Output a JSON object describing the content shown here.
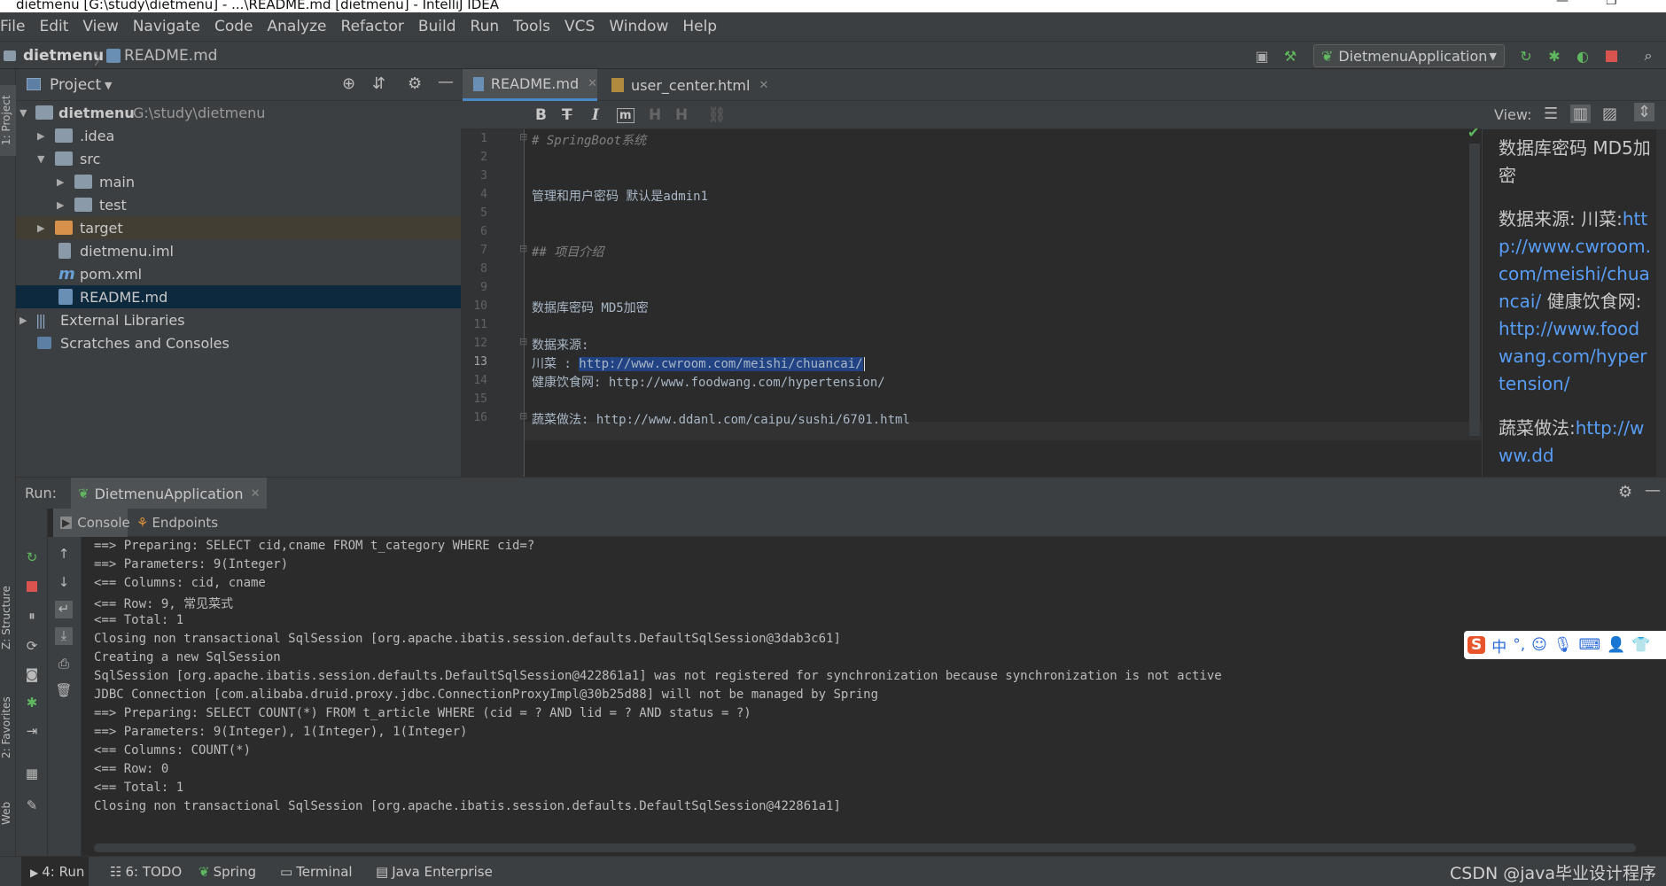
{
  "window": {
    "title": "dietmenu [G:\\study\\dietmenu] - ...\\README.md [dietmenu] - IntelliJ IDEA"
  },
  "menu": [
    "File",
    "Edit",
    "View",
    "Navigate",
    "Code",
    "Analyze",
    "Refactor",
    "Build",
    "Run",
    "Tools",
    "VCS",
    "Window",
    "Help"
  ],
  "navbar": {
    "project": "dietmenu",
    "file": "README.md",
    "run_config": "DietmenuApplication"
  },
  "project_panel": {
    "title": "Project",
    "tree": [
      {
        "label": "dietmenu",
        "path": "G:\\study\\dietmenu",
        "level": 0
      },
      {
        "label": ".idea",
        "level": 1
      },
      {
        "label": "src",
        "level": 1
      },
      {
        "label": "main",
        "level": 2
      },
      {
        "label": "test",
        "level": 2
      },
      {
        "label": "target",
        "level": 1
      },
      {
        "label": "dietmenu.iml",
        "level": 1
      },
      {
        "label": "pom.xml",
        "level": 1
      },
      {
        "label": "README.md",
        "level": 1
      },
      {
        "label": "External Libraries",
        "level": 0
      },
      {
        "label": "Scratches and Consoles",
        "level": 0
      }
    ]
  },
  "editor": {
    "tabs": [
      {
        "label": "README.md",
        "active": true
      },
      {
        "label": "user_center.html",
        "active": false
      }
    ],
    "toolbar": {
      "bold": "B",
      "strike": "T",
      "italic": "I",
      "code": "m",
      "h1": "H",
      "h2": "H"
    },
    "lines": [
      {
        "n": "1",
        "text": "# SpringBoot系统"
      },
      {
        "n": "2",
        "text": ""
      },
      {
        "n": "3",
        "text": ""
      },
      {
        "n": "4",
        "text": "管理和用户密码 默认是admin1"
      },
      {
        "n": "5",
        "text": ""
      },
      {
        "n": "6",
        "text": ""
      },
      {
        "n": "7",
        "text": "## 项目介绍"
      },
      {
        "n": "8",
        "text": ""
      },
      {
        "n": "9",
        "text": ""
      },
      {
        "n": "10",
        "text": "数据库密码  MD5加密"
      },
      {
        "n": "11",
        "text": ""
      },
      {
        "n": "12",
        "text": "数据来源:"
      },
      {
        "n": "13",
        "text_prefix": "川菜 :",
        "text_selected": "http://www.cwroom.com/meishi/chuancai/"
      },
      {
        "n": "14",
        "text": "健康饮食网: http://www.foodwang.com/hypertension/"
      },
      {
        "n": "15",
        "text": ""
      },
      {
        "n": "16",
        "text": "蔬菜做法: http://www.ddanl.com/caipu/sushi/6701.html"
      }
    ]
  },
  "preview": {
    "view_label": "View:",
    "p1": "数据库密码 MD5加密",
    "p2_prefix": "数据来源: 川菜:",
    "p2_link1": "http://www.cwroom.com/meishi/chuancai/",
    "p2_mid": "健康饮食网:",
    "p2_link2": "http://www.foodwang.com/hypertension/",
    "p3_prefix": "蔬菜做法:",
    "p3_link": "http://www.dd"
  },
  "run": {
    "label": "Run:",
    "config": "DietmenuApplication",
    "subtabs": [
      "Console",
      "Endpoints"
    ],
    "console": [
      "==>  Preparing: SELECT cid,cname FROM t_category WHERE cid=?",
      "==> Parameters: 9(Integer)",
      "<==    Columns: cid, cname",
      "<==        Row: 9, 常见菜式",
      "<==      Total: 1",
      "Closing non transactional SqlSession [org.apache.ibatis.session.defaults.DefaultSqlSession@3dab3c61]",
      "Creating a new SqlSession",
      "SqlSession [org.apache.ibatis.session.defaults.DefaultSqlSession@422861a1] was not registered for synchronization because synchronization is not active",
      "JDBC Connection [com.alibaba.druid.proxy.jdbc.ConnectionProxyImpl@30b25d88] will not be managed by Spring",
      "==>  Preparing: SELECT COUNT(*) FROM t_article WHERE (cid = ? AND lid = ? AND status = ?)",
      "==> Parameters: 9(Integer), 1(Integer), 1(Integer)",
      "<==    Columns: COUNT(*)",
      "<==        Row: 0",
      "<==      Total: 1",
      "Closing non transactional SqlSession [org.apache.ibatis.session.defaults.DefaultSqlSession@422861a1]"
    ]
  },
  "left_strip": {
    "project": "1: Project",
    "structure": "Z: Structure",
    "favorites": "2: Favorites",
    "web": "Web"
  },
  "bottom_tabs": [
    "4: Run",
    "6: TODO",
    "Spring",
    "Terminal",
    "Java Enterprise"
  ],
  "watermark": "CSDN @java毕业设计程序"
}
